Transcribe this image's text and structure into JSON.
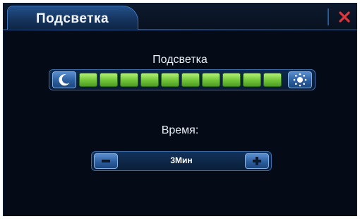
{
  "window": {
    "title": "Подсветка",
    "close_icon": "close-icon"
  },
  "brightness": {
    "label": "Подсветка",
    "min_icon": "moon-icon",
    "max_icon": "sun-icon",
    "level": 10,
    "max_level": 10
  },
  "time": {
    "label": "Время:",
    "value": "3Мин",
    "decrease_icon": "minus-icon",
    "increase_icon": "plus-icon"
  },
  "colors": {
    "accent_blue": "#2d5f9f",
    "segment_green": "#74c83a",
    "close_red": "#e0353a",
    "background": "#050b16"
  }
}
